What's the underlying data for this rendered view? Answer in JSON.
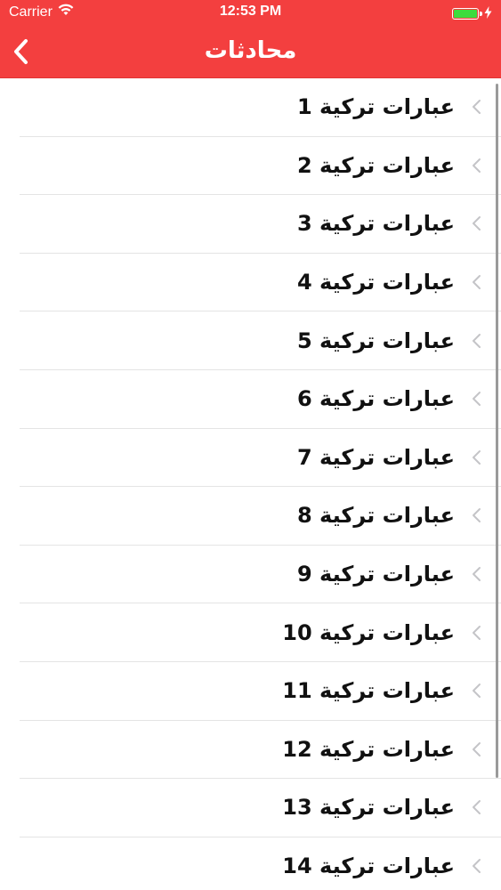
{
  "status_bar": {
    "carrier": "Carrier",
    "time": "12:53 PM",
    "battery_level": 1.0
  },
  "nav": {
    "title": "محادثات"
  },
  "list": {
    "items": [
      {
        "label": "عبارات تركية 1"
      },
      {
        "label": "عبارات تركية 2"
      },
      {
        "label": "عبارات تركية 3"
      },
      {
        "label": "عبارات تركية 4"
      },
      {
        "label": "عبارات تركية 5"
      },
      {
        "label": "عبارات تركية 6"
      },
      {
        "label": "عبارات تركية 7"
      },
      {
        "label": "عبارات تركية 8"
      },
      {
        "label": "عبارات تركية 9"
      },
      {
        "label": "عبارات تركية 10"
      },
      {
        "label": "عبارات تركية 11"
      },
      {
        "label": "عبارات تركية 12"
      },
      {
        "label": "عبارات تركية 13"
      },
      {
        "label": "عبارات تركية 14"
      }
    ]
  },
  "colors": {
    "header": "#f33f3f",
    "header_text": "#ffffff",
    "battery": "#3ddc3d",
    "row_text": "#111111",
    "separator": "#e4e4e4",
    "chevron": "#c4c4c7"
  },
  "icons": {
    "back": "chevron-left-icon",
    "row": "chevron-left-icon",
    "wifi": "wifi-icon",
    "battery": "battery-icon",
    "charging": "charging-bolt-icon"
  }
}
